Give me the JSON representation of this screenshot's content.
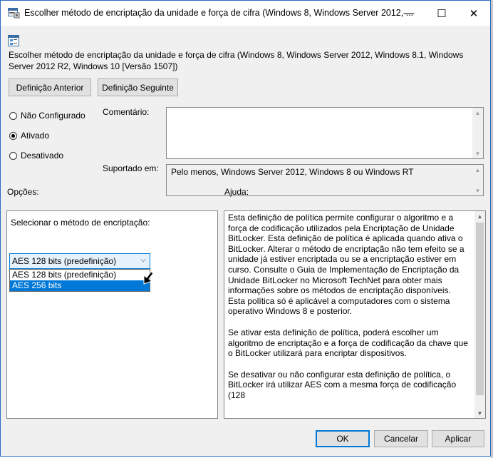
{
  "window": {
    "title": "Escolher método de encriptação da unidade e força de cifra (Windows 8, Windows Server 2012, ...",
    "minimize_glyph": "—",
    "maximize_glyph": "☐",
    "close_glyph": "✕"
  },
  "header": {
    "policy_text": "Escolher método de encriptação da unidade e força de cifra (Windows 8, Windows Server 2012, Windows 8.1, Windows Server 2012 R2, Windows 10 [Versão 1507])"
  },
  "nav": {
    "prev_label": "Definição Anterior",
    "next_label": "Definição Seguinte"
  },
  "state": {
    "options": [
      {
        "label": "Não Configurado",
        "selected": false
      },
      {
        "label": "Ativado",
        "selected": true
      },
      {
        "label": "Desativado",
        "selected": false
      }
    ]
  },
  "comment": {
    "label": "Comentário:",
    "value": ""
  },
  "supported": {
    "label": "Suportado em:",
    "value": "Pelo menos, Windows Server 2012, Windows 8 ou Windows RT"
  },
  "options_panel": {
    "heading": "Opções:",
    "field_label": "Selecionar o método de encriptação:",
    "selected_value": "AES 128 bits (predefinição)",
    "dropdown_items": [
      "AES 128 bits (predefinição)",
      "AES 256 bits"
    ],
    "highlighted_index": 1
  },
  "help_panel": {
    "heading": "Ajuda:",
    "paragraphs": [
      "Esta definição de política permite configurar o algoritmo e a força de codificação utilizados pela Encriptação de Unidade BitLocker. Esta definição de política é aplicada quando ativa o BitLocker. Alterar o método de encriptação não tem efeito se a unidade já estiver encriptada ou se a encriptação estiver em curso. Consulte o Guia de Implementação de Encriptação da Unidade BitLocker no Microsoft TechNet para obter mais informações sobre os métodos de encriptação disponíveis. Esta política só é aplicável a computadores com o sistema operativo Windows 8 e posterior.",
      "Se ativar esta definição de política, poderá escolher um algoritmo de encriptação e a força de codificação da chave que o BitLocker utilizará para encriptar dispositivos.",
      "Se desativar ou não configurar esta definição de política, o BitLocker irá utilizar AES com a mesma força de codificação (128"
    ]
  },
  "footer": {
    "ok_label": "OK",
    "cancel_label": "Cancelar",
    "apply_label": "Aplicar"
  },
  "icons": [
    "policy-window-icon",
    "policy-setting-icon",
    "mouse-cursor-icon",
    "chevron-down-icon"
  ]
}
